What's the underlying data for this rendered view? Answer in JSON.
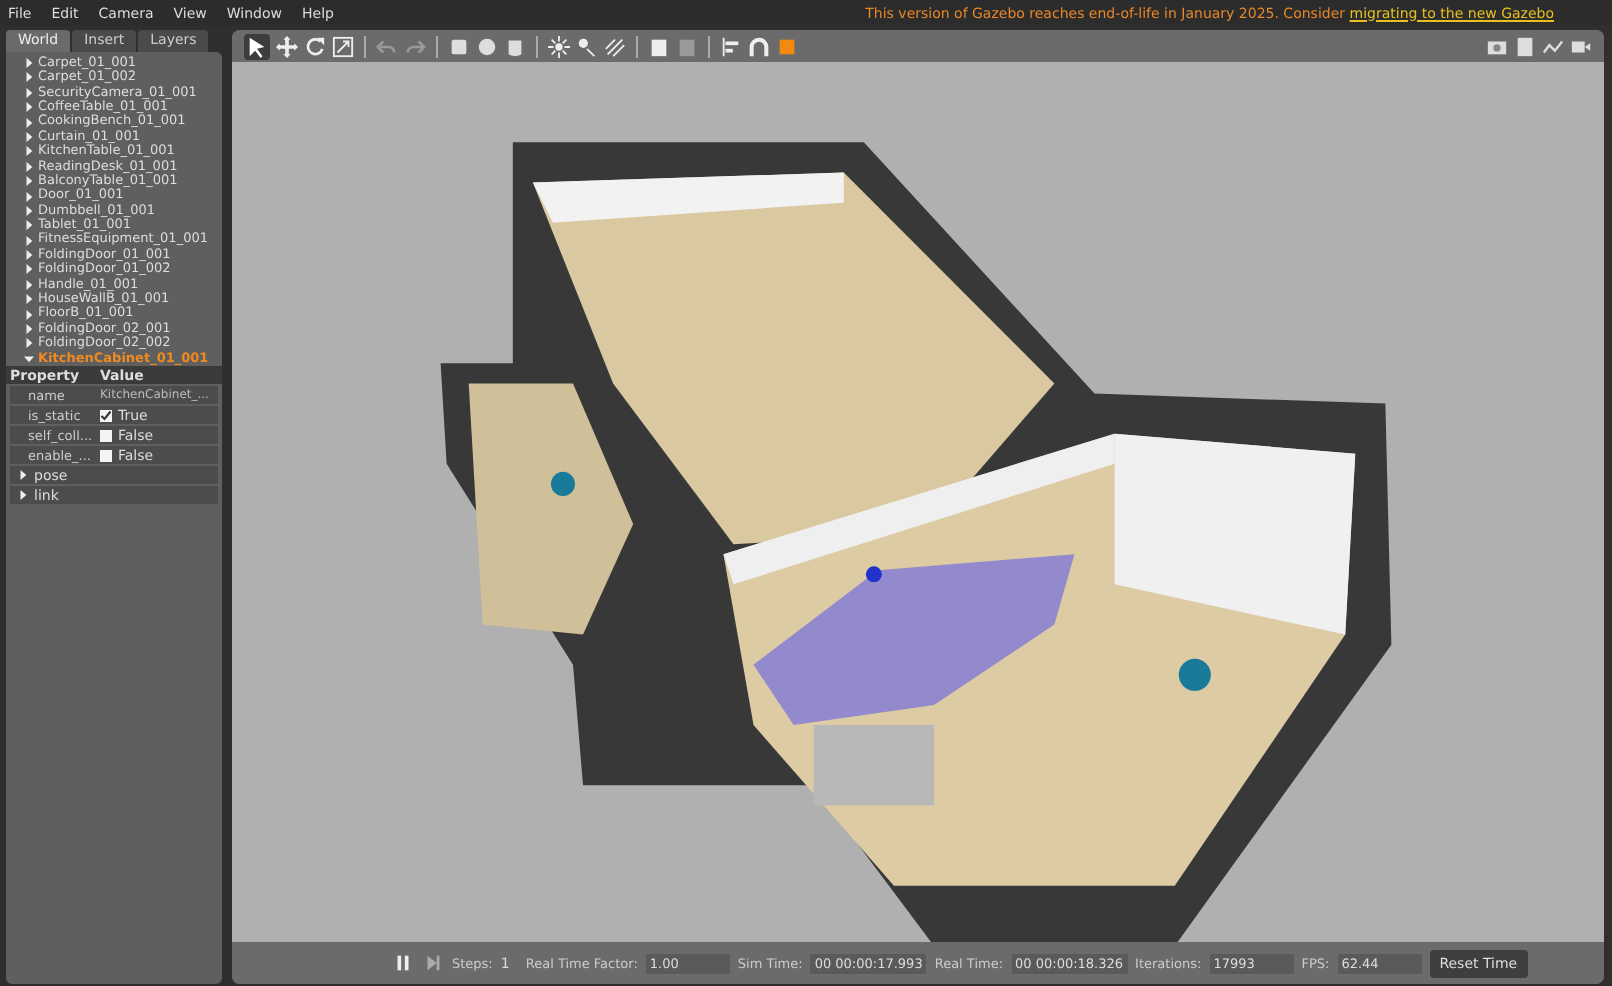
{
  "menu": [
    "File",
    "Edit",
    "Camera",
    "View",
    "Window",
    "Help"
  ],
  "notice": {
    "text": "This version of Gazebo reaches end-of-life in January 2025. Consider ",
    "link": "migrating to the new Gazebo"
  },
  "tabs": [
    {
      "label": "World",
      "selected": true
    },
    {
      "label": "Insert",
      "selected": false
    },
    {
      "label": "Layers",
      "selected": false
    }
  ],
  "tree": [
    {
      "label": "Carpet_01_001",
      "selected": false,
      "expanded": false
    },
    {
      "label": "Carpet_01_002",
      "selected": false,
      "expanded": false
    },
    {
      "label": "SecurityCamera_01_001",
      "selected": false,
      "expanded": false
    },
    {
      "label": "CoffeeTable_01_001",
      "selected": false,
      "expanded": false
    },
    {
      "label": "CookingBench_01_001",
      "selected": false,
      "expanded": false
    },
    {
      "label": "Curtain_01_001",
      "selected": false,
      "expanded": false
    },
    {
      "label": "KitchenTable_01_001",
      "selected": false,
      "expanded": false
    },
    {
      "label": "ReadingDesk_01_001",
      "selected": false,
      "expanded": false
    },
    {
      "label": "BalconyTable_01_001",
      "selected": false,
      "expanded": false
    },
    {
      "label": "Door_01_001",
      "selected": false,
      "expanded": false
    },
    {
      "label": "Dumbbell_01_001",
      "selected": false,
      "expanded": false
    },
    {
      "label": "Tablet_01_001",
      "selected": false,
      "expanded": false
    },
    {
      "label": "FitnessEquipment_01_001",
      "selected": false,
      "expanded": false
    },
    {
      "label": "FoldingDoor_01_001",
      "selected": false,
      "expanded": false
    },
    {
      "label": "FoldingDoor_01_002",
      "selected": false,
      "expanded": false
    },
    {
      "label": "Handle_01_001",
      "selected": false,
      "expanded": false
    },
    {
      "label": "HouseWallB_01_001",
      "selected": false,
      "expanded": false
    },
    {
      "label": "FloorB_01_001",
      "selected": false,
      "expanded": false
    },
    {
      "label": "FoldingDoor_02_001",
      "selected": false,
      "expanded": false
    },
    {
      "label": "FoldingDoor_02_002",
      "selected": false,
      "expanded": false
    },
    {
      "label": "KitchenCabinet_01_001",
      "selected": true,
      "expanded": true
    }
  ],
  "properties": {
    "columns": [
      "Property",
      "Value"
    ],
    "rows": [
      {
        "kind": "text",
        "name": "name",
        "value": "KitchenCabinet_..."
      },
      {
        "kind": "checkbox",
        "name": "is_static",
        "value": "True",
        "checked": true
      },
      {
        "kind": "checkbox",
        "name": "self_coll...",
        "value": "False",
        "checked": false
      },
      {
        "kind": "checkbox",
        "name": "enable_...",
        "value": "False",
        "checked": false
      }
    ],
    "sections": [
      {
        "label": "pose",
        "expanded": false
      },
      {
        "label": "link",
        "expanded": false
      }
    ]
  },
  "status": {
    "steps_label": "Steps:",
    "steps": "1",
    "rtf_label": "Real Time Factor:",
    "rtf": "1.00",
    "sim_label": "Sim Time:",
    "sim": "00 00:00:17.993",
    "real_label": "Real Time:",
    "real": "00 00:00:18.326",
    "iter_label": "Iterations:",
    "iter": "17993",
    "fps_label": "FPS:",
    "fps": "62.44",
    "reset": "Reset Time"
  }
}
